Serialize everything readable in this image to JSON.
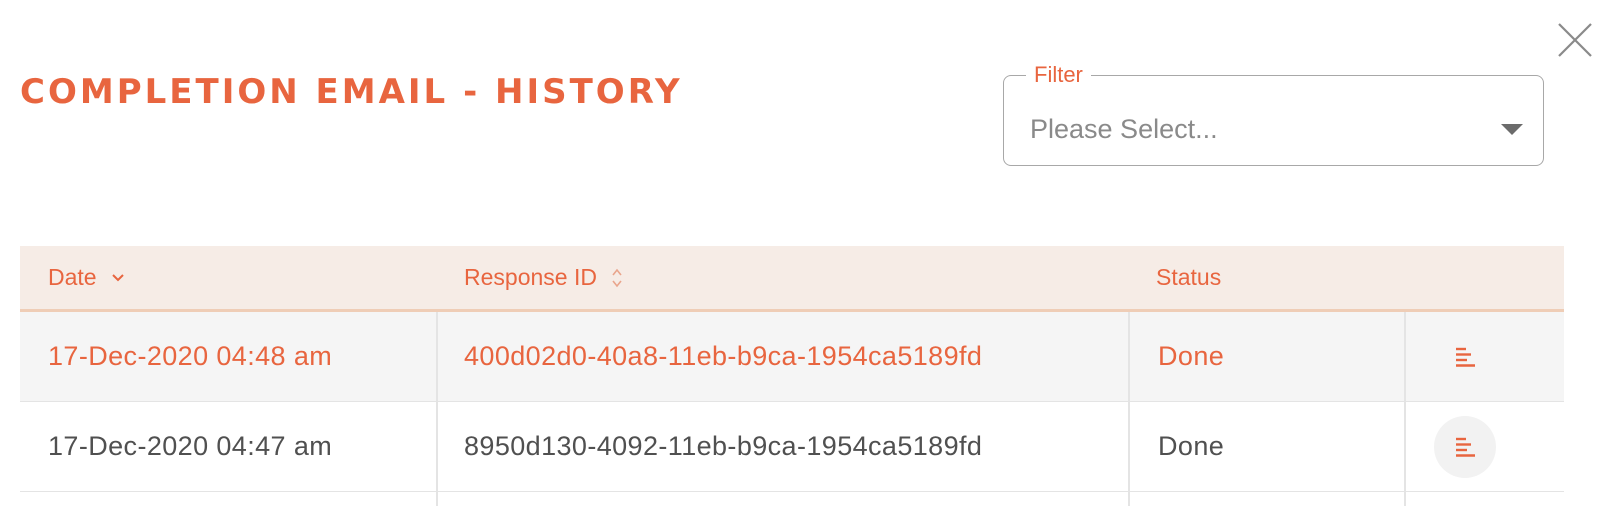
{
  "dialog": {
    "title": "COMPLETION EMAIL - HISTORY",
    "close_icon": "close-icon"
  },
  "filter": {
    "label": "Filter",
    "value": "Please Select...",
    "caret_icon": "caret-down-icon"
  },
  "table": {
    "columns": [
      {
        "label": "Date",
        "sort_icon": "chevron-down-icon"
      },
      {
        "label": "Response ID",
        "sort_icon": "sort-updown-icon"
      },
      {
        "label": "Status"
      }
    ],
    "rows": [
      {
        "date": "17-Dec-2020 04:48 am",
        "response_id": "400d02d0-40a8-11eb-b9ca-1954ca5189fd",
        "status": "Done",
        "action_icon": "details-lines-icon",
        "highlighted": true
      },
      {
        "date": "17-Dec-2020 04:47 am",
        "response_id": "8950d130-4092-11eb-b9ca-1954ca5189fd",
        "status": "Done",
        "action_icon": "details-lines-icon",
        "highlighted": false
      }
    ]
  },
  "colors": {
    "accent": "#e8653f",
    "header_bg": "#f6ece6",
    "header_border": "#efcdb6",
    "row_highlight_bg": "#f5f5f5",
    "text_default": "#505050",
    "placeholder": "#8a8a8a"
  }
}
